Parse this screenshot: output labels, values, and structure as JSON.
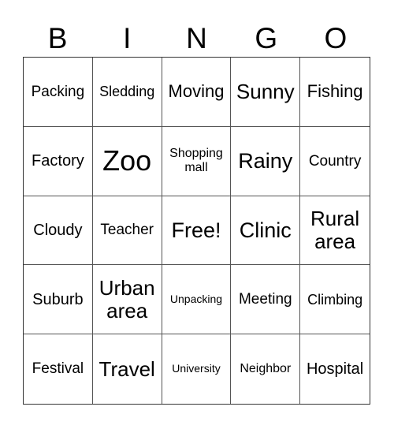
{
  "header": [
    "B",
    "I",
    "N",
    "G",
    "O"
  ],
  "cells": [
    {
      "text": "Packing",
      "size": "s19"
    },
    {
      "text": "Sledding",
      "size": "s18"
    },
    {
      "text": "Moving",
      "size": "s22"
    },
    {
      "text": "Sunny",
      "size": "s26"
    },
    {
      "text": "Fishing",
      "size": "s22"
    },
    {
      "text": "Factory",
      "size": "s20"
    },
    {
      "text": "Zoo",
      "size": "s36"
    },
    {
      "text": "Shopping mall",
      "size": "s16"
    },
    {
      "text": "Rainy",
      "size": "s27"
    },
    {
      "text": "Country",
      "size": "s19"
    },
    {
      "text": "Cloudy",
      "size": "s20"
    },
    {
      "text": "Teacher",
      "size": "s19"
    },
    {
      "text": "Free!",
      "size": "s27"
    },
    {
      "text": "Clinic",
      "size": "s27"
    },
    {
      "text": "Rural area",
      "size": "s26"
    },
    {
      "text": "Suburb",
      "size": "s20"
    },
    {
      "text": "Urban area",
      "size": "s26"
    },
    {
      "text": "Unpacking",
      "size": "s14"
    },
    {
      "text": "Meeting",
      "size": "s19"
    },
    {
      "text": "Climbing",
      "size": "s18"
    },
    {
      "text": "Festival",
      "size": "s19"
    },
    {
      "text": "Travel",
      "size": "s26"
    },
    {
      "text": "University",
      "size": "s14"
    },
    {
      "text": "Neighbor",
      "size": "s16"
    },
    {
      "text": "Hospital",
      "size": "s20"
    }
  ]
}
